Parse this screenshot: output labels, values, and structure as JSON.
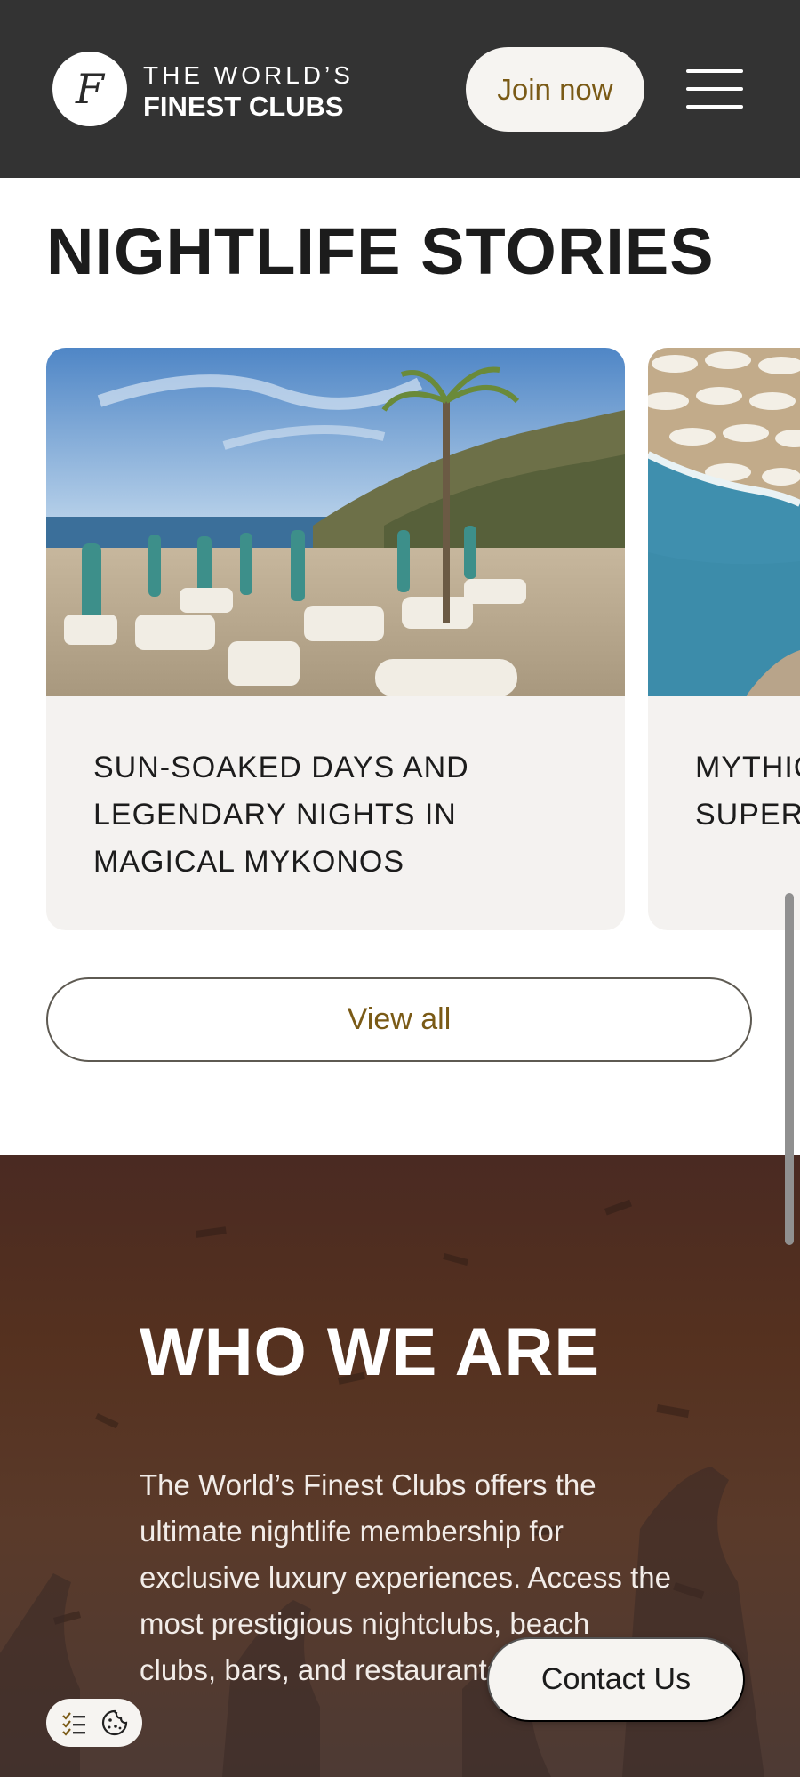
{
  "header": {
    "logo_monogram": "F",
    "logo_line1": "THE WORLD’S",
    "logo_line2": "FINEST CLUBS",
    "join_label": "Join now",
    "menu_icon": "hamburger-menu-icon"
  },
  "stories": {
    "title": "NIGHTLIFE STORIES",
    "cards": [
      {
        "title": "SUN-SOAKED DAYS AND LEGENDARY NIGHTS IN MAGICAL MYKONOS"
      },
      {
        "title": "MYTHIC\nSUPER"
      }
    ],
    "view_all_label": "View all"
  },
  "who": {
    "title": "WHO WE ARE",
    "text": "The World’s Finest Clubs offers the ultimate nightlife membership for exclusive luxury experiences. Access the most prestigious nightclubs, beach clubs, bars, and restaurants worldwide."
  },
  "floating": {
    "contact_label": "Contact Us",
    "cookie_icons": [
      "checklist-icon",
      "cookie-icon"
    ]
  },
  "colors": {
    "header_bg": "#333333",
    "accent_gold": "#7a5a16",
    "card_bg": "#f4f2f0",
    "who_bg": "#4a2a22"
  }
}
